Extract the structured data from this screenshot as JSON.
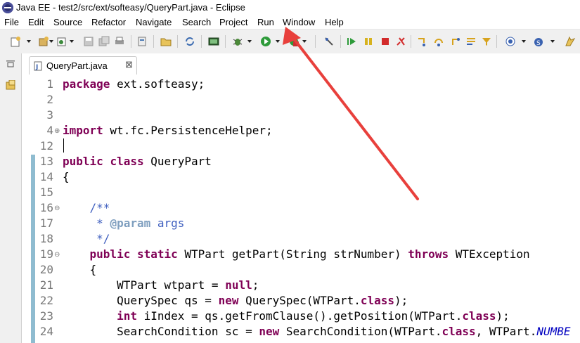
{
  "window": {
    "title": "Java EE - test2/src/ext/softeasy/QueryPart.java - Eclipse"
  },
  "menu": [
    "File",
    "Edit",
    "Source",
    "Refactor",
    "Navigate",
    "Search",
    "Project",
    "Run",
    "Window",
    "Help"
  ],
  "editor": {
    "tab_label": "QueryPart.java",
    "tab_close": "⊠",
    "lines": [
      {
        "num": "1",
        "text": "package ext.softeasy;"
      },
      {
        "num": "2",
        "text": ""
      },
      {
        "num": "3",
        "text": ""
      },
      {
        "num": "4",
        "text": "import wt.fc.PersistenceHelper;"
      },
      {
        "num": "12",
        "text": ""
      },
      {
        "num": "13",
        "text": "public class QueryPart"
      },
      {
        "num": "14",
        "text": "{"
      },
      {
        "num": "15",
        "text": ""
      },
      {
        "num": "16",
        "text": "    /**"
      },
      {
        "num": "17",
        "text": "     * @param args"
      },
      {
        "num": "18",
        "text": "     */"
      },
      {
        "num": "19",
        "text": "    public static WTPart getPart(String strNumber) throws WTException"
      },
      {
        "num": "20",
        "text": "    {"
      },
      {
        "num": "21",
        "text": "        WTPart wtpart = null;"
      },
      {
        "num": "22",
        "text": "        QuerySpec qs = new QuerySpec(WTPart.class);"
      },
      {
        "num": "23",
        "text": "        int iIndex = qs.getFromClause().getPosition(WTPart.class);"
      },
      {
        "num": "24",
        "text": "        SearchCondition sc = new SearchCondition(WTPart.class, WTPart.NUMBE"
      }
    ]
  },
  "annotation": {
    "color": "#e8403c",
    "points_to": "Window"
  }
}
